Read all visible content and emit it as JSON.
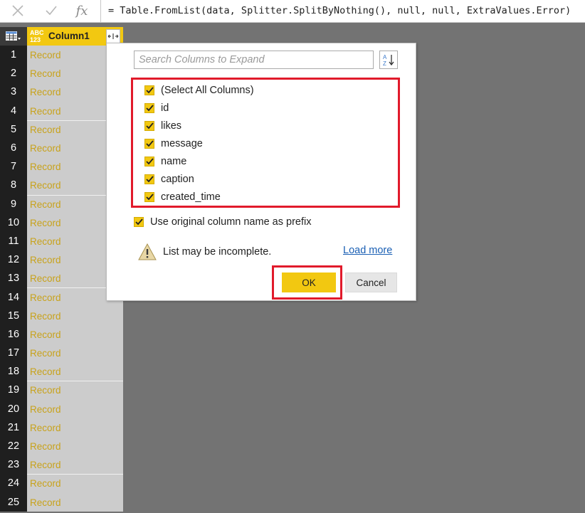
{
  "formula_bar": {
    "cancel_icon": "close-icon",
    "commit_icon": "check-icon",
    "fx_label": "fx",
    "formula": "= Table.FromList(data, Splitter.SplitByNothing(), null, null, ExtraValues.Error)"
  },
  "grid": {
    "type_icon_top": "ABC",
    "type_icon_bottom": "123",
    "column_name": "Column1",
    "rows": [
      {
        "n": "1",
        "v": "Record"
      },
      {
        "n": "2",
        "v": "Record"
      },
      {
        "n": "3",
        "v": "Record"
      },
      {
        "n": "4",
        "v": "Record"
      },
      {
        "n": "5",
        "v": "Record"
      },
      {
        "n": "6",
        "v": "Record"
      },
      {
        "n": "7",
        "v": "Record"
      },
      {
        "n": "8",
        "v": "Record"
      },
      {
        "n": "9",
        "v": "Record"
      },
      {
        "n": "10",
        "v": "Record"
      },
      {
        "n": "11",
        "v": "Record"
      },
      {
        "n": "12",
        "v": "Record"
      },
      {
        "n": "13",
        "v": "Record"
      },
      {
        "n": "14",
        "v": "Record"
      },
      {
        "n": "15",
        "v": "Record"
      },
      {
        "n": "16",
        "v": "Record"
      },
      {
        "n": "17",
        "v": "Record"
      },
      {
        "n": "18",
        "v": "Record"
      },
      {
        "n": "19",
        "v": "Record"
      },
      {
        "n": "20",
        "v": "Record"
      },
      {
        "n": "21",
        "v": "Record"
      },
      {
        "n": "22",
        "v": "Record"
      },
      {
        "n": "23",
        "v": "Record"
      },
      {
        "n": "24",
        "v": "Record"
      },
      {
        "n": "25",
        "v": "Record"
      }
    ]
  },
  "dialog": {
    "search_placeholder": "Search Columns to Expand",
    "columns": [
      {
        "label": "(Select All Columns)",
        "checked": true
      },
      {
        "label": "id",
        "checked": true
      },
      {
        "label": "likes",
        "checked": true
      },
      {
        "label": "message",
        "checked": true
      },
      {
        "label": "name",
        "checked": true
      },
      {
        "label": "caption",
        "checked": true
      },
      {
        "label": "created_time",
        "checked": true
      }
    ],
    "prefix_label": "Use original column name as prefix",
    "prefix_checked": true,
    "warning_text": "List may be incomplete.",
    "load_more": "Load more",
    "ok_label": "OK",
    "cancel_label": "Cancel"
  },
  "colors": {
    "accent": "#f2c811",
    "highlight": "#e11a2b",
    "record_text": "#c8a21a",
    "workspace": "#737373"
  }
}
